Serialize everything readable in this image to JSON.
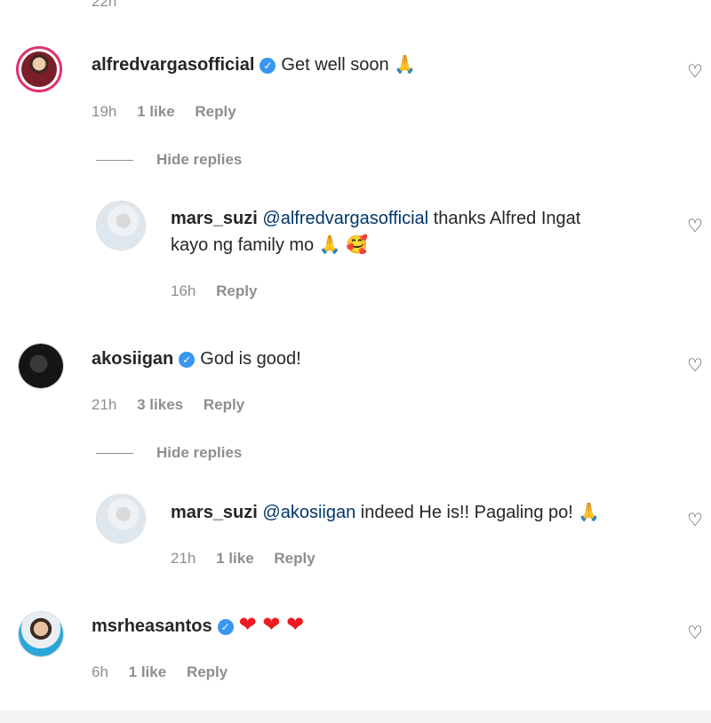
{
  "top_time": "22h",
  "comments": [
    {
      "username": "alfredvargasofficial",
      "verified": true,
      "text": "Get well soon",
      "emoji": "🙏",
      "time": "19h",
      "likes": "1 like",
      "reply": "Reply",
      "hide_replies": "Hide replies",
      "reply_item": {
        "username": "mars_suzi",
        "mention": "@alfredvargasofficial",
        "text_line1": " thanks Alfred Ingat",
        "text_line2": "kayo ng family mo",
        "emoji": "🙏 🥰",
        "time": "16h",
        "reply": "Reply"
      }
    },
    {
      "username": "akosiigan",
      "verified": true,
      "text": "God is good!",
      "time": "21h",
      "likes": "3 likes",
      "reply": "Reply",
      "hide_replies": "Hide replies",
      "reply_item": {
        "username": "mars_suzi",
        "mention": "@akosiigan",
        "text_line1": " indeed He is!! Pagaling po!",
        "emoji": "🙏",
        "time": "21h",
        "likes": "1 like",
        "reply": "Reply"
      }
    },
    {
      "username": "msrheasantos",
      "verified": true,
      "text": "❤ ❤ ❤",
      "time": "6h",
      "likes": "1 like",
      "reply": "Reply"
    }
  ],
  "icons": {
    "like": "heart-outline-icon",
    "verified": "verified-badge-icon"
  },
  "colors": {
    "verified": "#3897f0",
    "mention": "#00376b",
    "heart": "#ed1c24"
  }
}
